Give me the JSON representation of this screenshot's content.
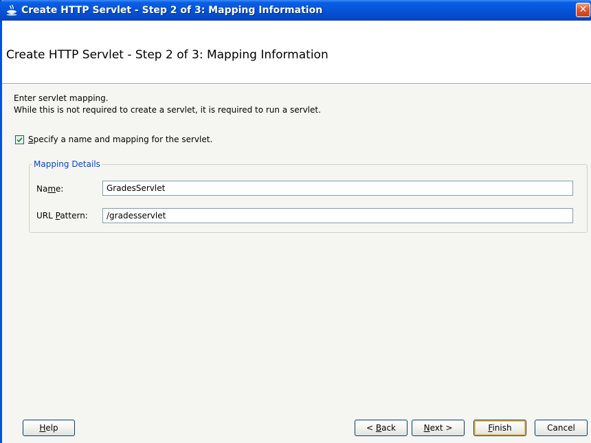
{
  "window": {
    "title": "Create HTTP Servlet - Step 2 of 3: Mapping Information",
    "close_glyph": "✕"
  },
  "header": {
    "heading": "Create HTTP Servlet - Step 2 of 3: Mapping Information"
  },
  "body": {
    "intro_line1": "Enter servlet mapping.",
    "intro_line2": "While this is not required to create a servlet, it is required to run a servlet.",
    "specify_checkbox": {
      "checked": true,
      "label_mnemonic": "S",
      "label_rest": "pecify a name and mapping for the servlet."
    },
    "mapping_group": {
      "legend": "Mapping Details",
      "name_label_pre": "Na",
      "name_label_mnemonic": "m",
      "name_label_post": "e:",
      "name_value": "GradesServlet",
      "url_label_pre": "URL ",
      "url_label_mnemonic": "P",
      "url_label_post": "attern:",
      "url_value": "/gradesservlet"
    }
  },
  "footer": {
    "help_mnemonic": "H",
    "help_rest": "elp",
    "back_pre": "< ",
    "back_mnemonic": "B",
    "back_rest": "ack",
    "next_mnemonic": "N",
    "next_rest": "ext >",
    "finish_mnemonic": "F",
    "finish_rest": "inish",
    "cancel": "Cancel"
  },
  "colors": {
    "titlebar_blue": "#0553d6",
    "legend_blue": "#0046d5",
    "default_button_highlight": "#f9b946"
  }
}
